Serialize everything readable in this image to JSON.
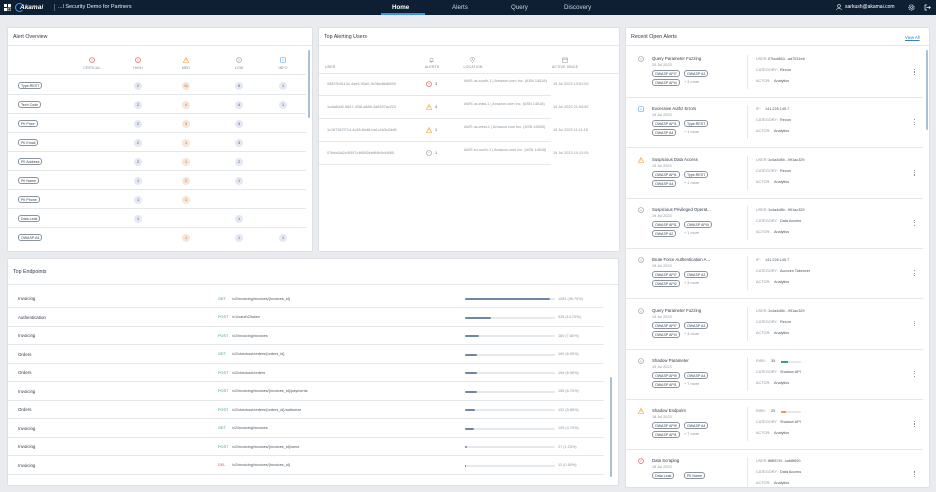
{
  "topbar": {
    "logo_text": "Akamai",
    "app_title": "...l Security Demo for Partners",
    "tabs": [
      {
        "label": "Home",
        "active": true
      },
      {
        "label": "Alerts",
        "active": false
      },
      {
        "label": "Query",
        "active": false
      },
      {
        "label": "Discovery",
        "active": false
      }
    ],
    "user_email": "sarkush@akamai.com"
  },
  "alert_overview": {
    "title": "Alert Overview",
    "columns": [
      "CRITICAL",
      "HIGH",
      "MED",
      "LOW",
      "INFO"
    ],
    "rows": [
      {
        "label": "Type:REST",
        "values": [
          "",
          "2",
          "11",
          "6",
          "1"
        ]
      },
      {
        "label": "Tech Code",
        "values": [
          "",
          "2",
          "4",
          "4",
          "1"
        ]
      },
      {
        "label": "PII Price",
        "values": [
          "",
          "2",
          "3",
          "3",
          ""
        ]
      },
      {
        "label": "PII Email",
        "values": [
          "",
          "2",
          "1",
          "3",
          ""
        ]
      },
      {
        "label": "PII Address",
        "values": [
          "",
          "2",
          "1",
          "2",
          ""
        ]
      },
      {
        "label": "PII Name",
        "values": [
          "",
          "1",
          "2",
          "1",
          ""
        ]
      },
      {
        "label": "PII Phone",
        "values": [
          "",
          "1",
          "1",
          "",
          ""
        ]
      },
      {
        "label": "Data Leak",
        "values": [
          "",
          "1",
          "",
          "1",
          ""
        ]
      },
      {
        "label": "OWASP A4",
        "values": [
          "",
          "",
          "1",
          "1",
          "1"
        ]
      }
    ]
  },
  "top_alerting_users": {
    "title": "Top Alerting Users",
    "columns": [
      "USER",
      "ALERTS",
      "LOCATION",
      "ACTIVE SINCE"
    ],
    "rows": [
      {
        "user": "08837b4113c-4ae6-90a0-3e36ed6d8699",
        "alerts": "3",
        "severity": "red",
        "location": "AWS us-south-1 | Amazon.com Inc. (ASN 14618)",
        "since": "19 Jul 2023 13:51:09"
      },
      {
        "user": "1c4a8dd0-5847-4f38-a888-4d8397ac223",
        "alerts": "4",
        "severity": "orange",
        "location": "AWS us-east-1 | Amazon.com Inc. (ASN 14618)",
        "since": "19 Jul 2023 21:54:52"
      },
      {
        "user": "1c187367f714-4c38-8ed8-ba1c1b3c2dd8",
        "alerts": "1",
        "severity": "orange",
        "location": "AWS us-west-1 | Amazon.com Inc. (ASN 16509)",
        "since": "19 Jul 2023 11:11:18"
      },
      {
        "user": "07bfdd4d2c9f397c4f68f2eb8f4b5c4f685",
        "alerts": "1",
        "severity": "gray",
        "location": "AWS eu-north-1 | Amazon.com Inc. (ASN 14618)",
        "since": "19 Jul 2023 14:12:05"
      }
    ]
  },
  "top_endpoints": {
    "title": "Top Endpoints",
    "rows": [
      {
        "name": "Invoicing",
        "method": "GET",
        "path": "/v2/invoicing/invoices/{invoices_id}",
        "pct": 47.0,
        "stat": "1281 (49.70%)"
      },
      {
        "name": "Authentication",
        "method": "POST",
        "path": "/v1/oauth2/token",
        "pct": 14.7,
        "stat": "326 (14.70%)"
      },
      {
        "name": "Invoicing",
        "method": "POST",
        "path": "/v2/invoicing/invoices",
        "pct": 7.9,
        "stat": "180 (7.80%)"
      },
      {
        "name": "Orders",
        "method": "GET",
        "path": "/v2/checkout/orders/{orders_id}",
        "pct": 6.9,
        "stat": "160 (6.90%)"
      },
      {
        "name": "Orders",
        "method": "POST",
        "path": "/v2/checkout/orders",
        "pct": 6.9,
        "stat": "154 (6.90%)"
      },
      {
        "name": "Invoicing",
        "method": "POST",
        "path": "/v2/invoicing/invoices/{invoices_id}/payments",
        "pct": 6.7,
        "stat": "155 (6.70%)"
      },
      {
        "name": "Orders",
        "method": "POST",
        "path": "/v2/checkout/orders/{orders_id}/authorize",
        "pct": 5.7,
        "stat": "132 (5.80%)"
      },
      {
        "name": "Invoicing",
        "method": "GET",
        "path": "/v2/invoicing/invoices",
        "pct": 4.9,
        "stat": "105 (4.70%)"
      },
      {
        "name": "Invoicing",
        "method": "POST",
        "path": "/v2/invoicing/invoices/{invoices_id}/send",
        "pct": 1.2,
        "stat": "27 (1.20%)"
      },
      {
        "name": "Invoicing",
        "method": "DEL",
        "path": "/v2/invoicing/invoices/{invoices_id}",
        "pct": 0.5,
        "stat": "12 (0.50%)"
      }
    ]
  },
  "recent_open_alerts": {
    "title": "Recent Open Alerts",
    "view_all": "View All",
    "items": [
      {
        "icon": "info",
        "title": "Query Parameter Fuzzing",
        "date": "20 Jul 2023",
        "tags": [
          "OWASP API7",
          "OWASP A3",
          "OWASP API4"
        ],
        "more": "+ 3 more",
        "user": "07bcd863...ad7031e6",
        "category": "Recon",
        "actor": "Analytics"
      },
      {
        "icon": "info-blue",
        "title": "Excessive Authz Errors",
        "date": "19 Jul 2023",
        "tags": [
          "OWASP API1",
          "Type:REST",
          "OWASP A4"
        ],
        "more": "+ 1 more",
        "ip": "141.226.145.7",
        "category": "Recon",
        "actor": "Analytics"
      },
      {
        "icon": "warn",
        "title": "Suspicious Data Access",
        "date": "19 Jul 2023",
        "tags": [
          "OWASP API1",
          "Type:REST",
          "OWASP A4"
        ],
        "more": "+ 1 more",
        "user": "1c4a4d8b...991ac329",
        "category": "Recon",
        "actor": "Analytics"
      },
      {
        "icon": "info",
        "title": "Suspicious Privileged Operat...",
        "date": "19 Jul 2023",
        "tags": [
          "OWASP API1",
          "OWASP API4",
          "OWASP A2"
        ],
        "more": "+ 1 more",
        "user": "1c4a4d8b...991ac329",
        "category": "Data Access",
        "actor": "Analytics"
      },
      {
        "icon": "info",
        "title": "Brute Force Authentication A...",
        "date": "19 Jul 2023",
        "tags": [
          "OWASP API7",
          "OWASP A3",
          "OWASP API2"
        ],
        "more": "+ 3 more",
        "ip": "141.226.145.7",
        "category": "Account Takeover",
        "actor": "Analytics"
      },
      {
        "icon": "info",
        "title": "Query Parameter Fuzzing",
        "date": "19 Jul 2023",
        "tags": [
          "OWASP API7",
          "OWASP A3",
          "OWASP API4"
        ],
        "more": "+ 3 more",
        "user": "1c4a4d8b...991ac329",
        "category": "Recon",
        "actor": "Analytics"
      },
      {
        "icon": "info",
        "title": "Shadow Parameter",
        "date": "19 Jul 2023",
        "tags": [
          "OWASP API9",
          "OWASP A4",
          "OWASP API1"
        ],
        "more": "+ 7 more",
        "risk": "35",
        "risk_level": "green",
        "category": "Shadow API",
        "actor": "Analytics"
      },
      {
        "icon": "warn",
        "title": "Shadow Endpoint",
        "date": "18 Jul 2023",
        "tags": [
          "OWASP API9",
          "OWASP A4",
          "OWASP API1"
        ],
        "more": "+ 7 more",
        "risk": "25",
        "risk_level": "orange",
        "category": "Shadow API",
        "actor": "Analytics"
      },
      {
        "icon": "alert-red",
        "title": "Data Scraping",
        "date": "18 Jul 2023",
        "tags": [
          "Data Leak",
          "PII Name"
        ],
        "more": "",
        "user": "8f8f574f...ca68f690",
        "category": "Data Access",
        "actor": "Analytics"
      }
    ],
    "labels": {
      "user": "USER:",
      "ip": "IP:",
      "risk": "RISK:",
      "category": "CATEGORY:",
      "actor": "ACTOR:"
    }
  },
  "colors": {
    "topbar": "#0e1f33",
    "accent": "#3c8fe6",
    "red": "#d9534f",
    "orange": "#f0a030",
    "bar": "#7086a8"
  }
}
